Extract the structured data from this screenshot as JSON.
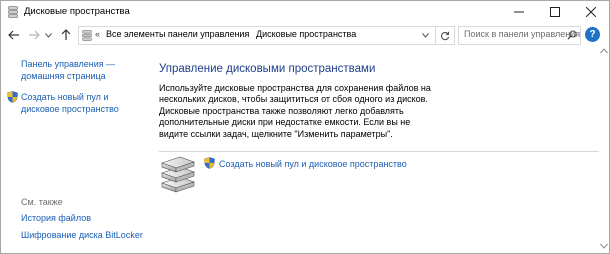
{
  "window": {
    "title": "Дисковые пространства"
  },
  "address_bar": {
    "separator": "«",
    "crumbs": [
      "Все элементы панели управления",
      "Дисковые пространства"
    ],
    "arrow": "›"
  },
  "search": {
    "placeholder": "Поиск в панели управления"
  },
  "left_pane": {
    "home_link": "Панель управления — домашняя страница",
    "create_link": "Создать новый пул и дисковое пространство",
    "see_also": "См. также",
    "history_link": "История файлов",
    "bitlocker_link": "Шифрование диска BitLocker"
  },
  "main": {
    "heading": "Управление дисковыми пространствами",
    "description": "Используйте дисковые пространства для сохранения файлов на нескольких дисков, чтобы защититься от сбоя одного из дисков. Дисковые пространства также позволяют легко добавлять дополнительные диски при недостатке емкости. Если вы не видите ссылки задач, щелкните \"Изменить параметры\".",
    "create_link": "Создать новый пул и дисковое пространство"
  },
  "colors": {
    "link": "#1a5fb4",
    "heading": "#1e3f8a",
    "help_button": "#1e73c8"
  }
}
